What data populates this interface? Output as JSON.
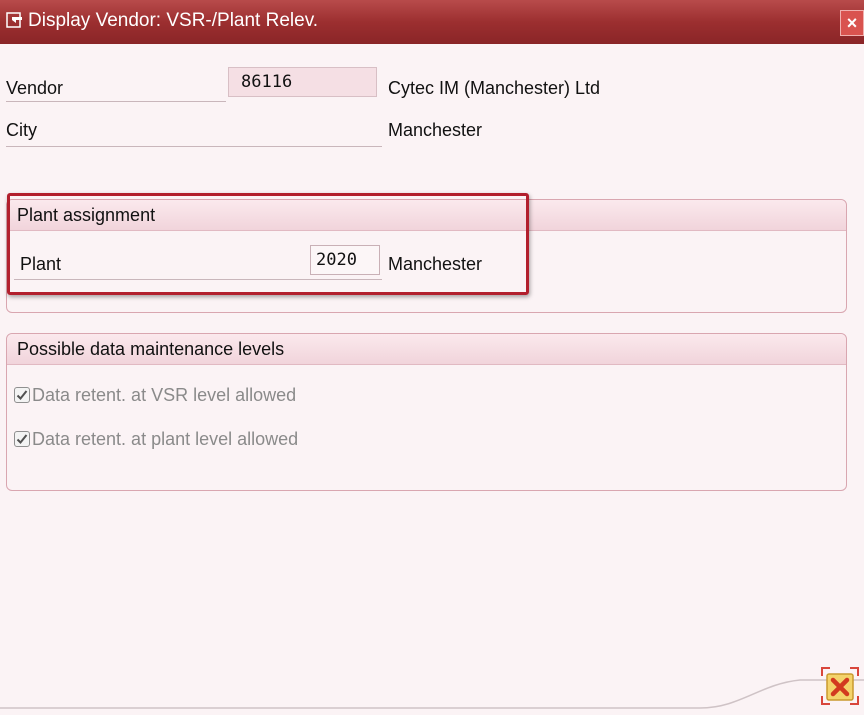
{
  "window": {
    "title": "Display Vendor: VSR-/Plant Relev.",
    "close_glyph": "×"
  },
  "vendor": {
    "label": "Vendor",
    "value": "86116",
    "name": "Cytec IM (Manchester) Ltd"
  },
  "city": {
    "label": "City",
    "value": "Manchester"
  },
  "plant_assignment": {
    "title": "Plant assignment",
    "plant_label": "Plant",
    "plant_value": "2020",
    "plant_name": "Manchester"
  },
  "maintenance_levels": {
    "title": "Possible data maintenance levels",
    "options": [
      {
        "label": "Data retent. at VSR level allowed",
        "checked": true
      },
      {
        "label": "Data retent. at plant level allowed",
        "checked": true
      }
    ]
  },
  "colors": {
    "titlebar": "#9c2f30",
    "background": "#fbf3f5",
    "highlight": "#b21f2d"
  }
}
